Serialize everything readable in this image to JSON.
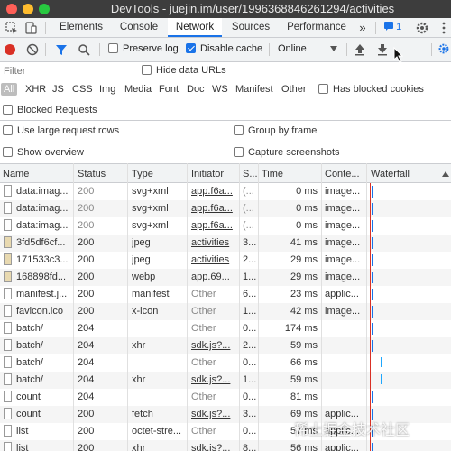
{
  "window": {
    "title": "DevTools - juejin.im/user/1996368846261294/activities"
  },
  "tabs": [
    {
      "label": "Elements"
    },
    {
      "label": "Console"
    },
    {
      "label": "Network",
      "active": true
    },
    {
      "label": "Sources"
    },
    {
      "label": "Performance"
    }
  ],
  "tab_more": "»",
  "tab_badge": "1",
  "toolbar": {
    "preserve_log": {
      "label": "Preserve log",
      "checked": false
    },
    "disable_cache": {
      "label": "Disable cache",
      "checked": true
    },
    "throttle": "Online"
  },
  "filter": {
    "placeholder": "Filter",
    "hide_data_urls": "Hide data URLs",
    "types": [
      "All",
      "XHR",
      "JS",
      "CSS",
      "Img",
      "Media",
      "Font",
      "Doc",
      "WS",
      "Manifest",
      "Other"
    ],
    "has_blocked_cookies": "Has blocked cookies",
    "blocked_requests": "Blocked Requests"
  },
  "options": {
    "use_large_rows": "Use large request rows",
    "group_by_frame": "Group by frame",
    "show_overview": "Show overview",
    "capture_screenshots": "Capture screenshots"
  },
  "columns": [
    "Name",
    "Status",
    "Type",
    "Initiator",
    "S...",
    "Time",
    "Conte...",
    "Waterfall"
  ],
  "rows": [
    {
      "name": "data:imag...",
      "status": "200",
      "type": "svg+xml",
      "initiator": "app.f6a...",
      "size": "(...",
      "time": "0 ms",
      "content": "image...",
      "dim": true
    },
    {
      "name": "data:imag...",
      "status": "200",
      "type": "svg+xml",
      "initiator": "app.f6a...",
      "size": "(...",
      "time": "0 ms",
      "content": "image...",
      "dim": true
    },
    {
      "name": "data:imag...",
      "status": "200",
      "type": "svg+xml",
      "initiator": "app.f6a...",
      "size": "(...",
      "time": "0 ms",
      "content": "image...",
      "dim": true
    },
    {
      "name": "3fd5df6cf...",
      "status": "200",
      "type": "jpeg",
      "initiator": "activities",
      "size": "3...",
      "time": "41 ms",
      "content": "image...",
      "dim": false
    },
    {
      "name": "171533c3...",
      "status": "200",
      "type": "jpeg",
      "initiator": "activities",
      "size": "2...",
      "time": "29 ms",
      "content": "image...",
      "dim": false
    },
    {
      "name": "168898fd...",
      "status": "200",
      "type": "webp",
      "initiator": "app.69...",
      "size": "1...",
      "time": "29 ms",
      "content": "image...",
      "dim": false
    },
    {
      "name": "manifest.j...",
      "status": "200",
      "type": "manifest",
      "initiator": "Other",
      "size": "6...",
      "time": "23 ms",
      "content": "applic...",
      "dim": false
    },
    {
      "name": "favicon.ico",
      "status": "200",
      "type": "x-icon",
      "initiator": "Other",
      "size": "1...",
      "time": "42 ms",
      "content": "image...",
      "dim": false
    },
    {
      "name": "batch/",
      "status": "204",
      "type": "",
      "initiator": "Other",
      "size": "0...",
      "time": "174 ms",
      "content": "",
      "dim": false
    },
    {
      "name": "batch/",
      "status": "204",
      "type": "xhr",
      "initiator": "sdk.js?...",
      "size": "2...",
      "time": "59 ms",
      "content": "",
      "dim": false
    },
    {
      "name": "batch/",
      "status": "204",
      "type": "",
      "initiator": "Other",
      "size": "0...",
      "time": "66 ms",
      "content": "",
      "dim": false
    },
    {
      "name": "batch/",
      "status": "204",
      "type": "xhr",
      "initiator": "sdk.js?...",
      "size": "1...",
      "time": "59 ms",
      "content": "",
      "dim": false
    },
    {
      "name": "count",
      "status": "204",
      "type": "",
      "initiator": "Other",
      "size": "0...",
      "time": "81 ms",
      "content": "",
      "dim": false
    },
    {
      "name": "count",
      "status": "200",
      "type": "fetch",
      "initiator": "sdk.js?...",
      "size": "3...",
      "time": "69 ms",
      "content": "applic...",
      "dim": false
    },
    {
      "name": "list",
      "status": "200",
      "type": "octet-stre...",
      "initiator": "Other",
      "size": "0...",
      "time": "57 ms",
      "content": "applic...",
      "dim": false
    },
    {
      "name": "list",
      "status": "200",
      "type": "xhr",
      "initiator": "sdk.js?...",
      "size": "8...",
      "time": "56 ms",
      "content": "applic...",
      "dim": false
    }
  ],
  "watermark": "稀土掘金技术社区"
}
